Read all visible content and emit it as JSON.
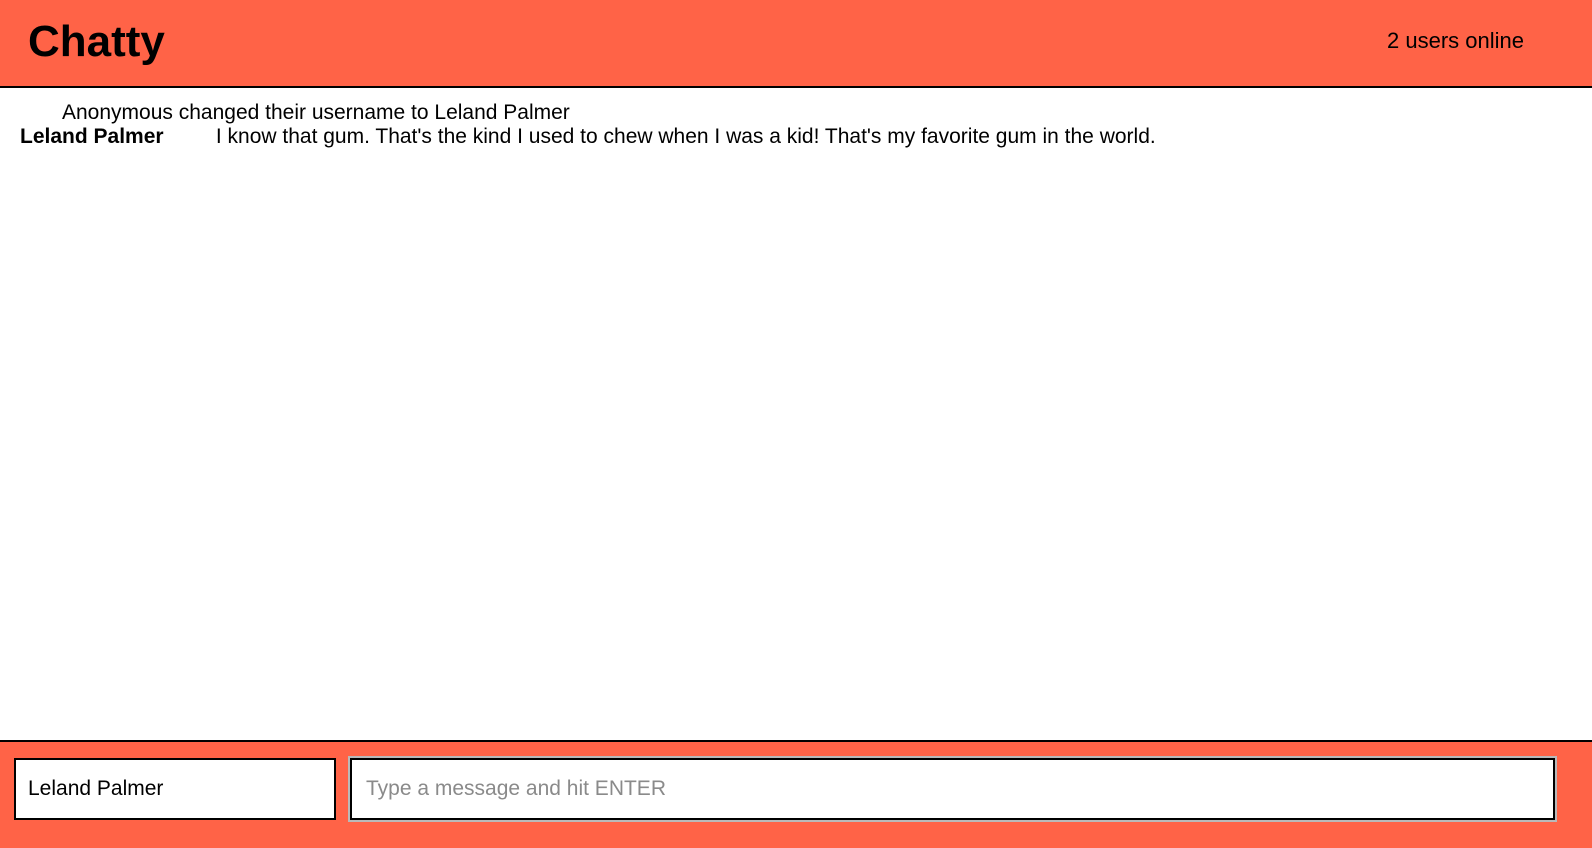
{
  "navbar": {
    "brand": "Chatty",
    "users_online": "2 users online"
  },
  "messages": {
    "system": [
      {
        "text": "Anonymous changed their username to Leland Palmer"
      }
    ],
    "chat": [
      {
        "username": "Leland Palmer",
        "content": "I know that gum. That's the kind I used to chew when I was a kid! That's my favorite gum in the world."
      }
    ]
  },
  "chatbar": {
    "username_value": "Leland Palmer",
    "message_placeholder": "Type a message and hit ENTER"
  },
  "colors": {
    "accent": "#ff6347",
    "border": "#000000"
  }
}
